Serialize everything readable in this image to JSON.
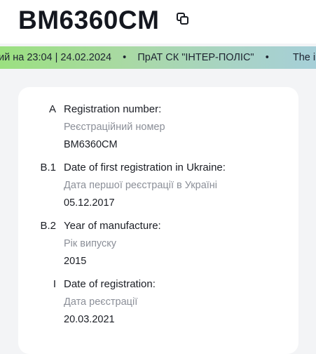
{
  "header": {
    "plate": "BM6360CM"
  },
  "ticker": {
    "items": [
      "ий на 23:04 | 24.02.2024",
      "ПрАТ СК \"ІНТЕР-ПОЛІС\"",
      "The in"
    ],
    "separator": "•"
  },
  "fields": [
    {
      "code": "A",
      "title": "Registration number:",
      "subtitle": "Реєстраційний номер",
      "value": "BM6360CM"
    },
    {
      "code": "B.1",
      "title": "Date of first registration in Ukraine:",
      "subtitle": "Дата першої реєстрації в Україні",
      "value": "05.12.2017"
    },
    {
      "code": "B.2",
      "title": "Year of manufacture:",
      "subtitle": "Рік випуску",
      "value": "2015"
    },
    {
      "code": "I",
      "title": "Date of registration:",
      "subtitle": "Дата реєстрації",
      "value": "20.03.2021"
    }
  ]
}
